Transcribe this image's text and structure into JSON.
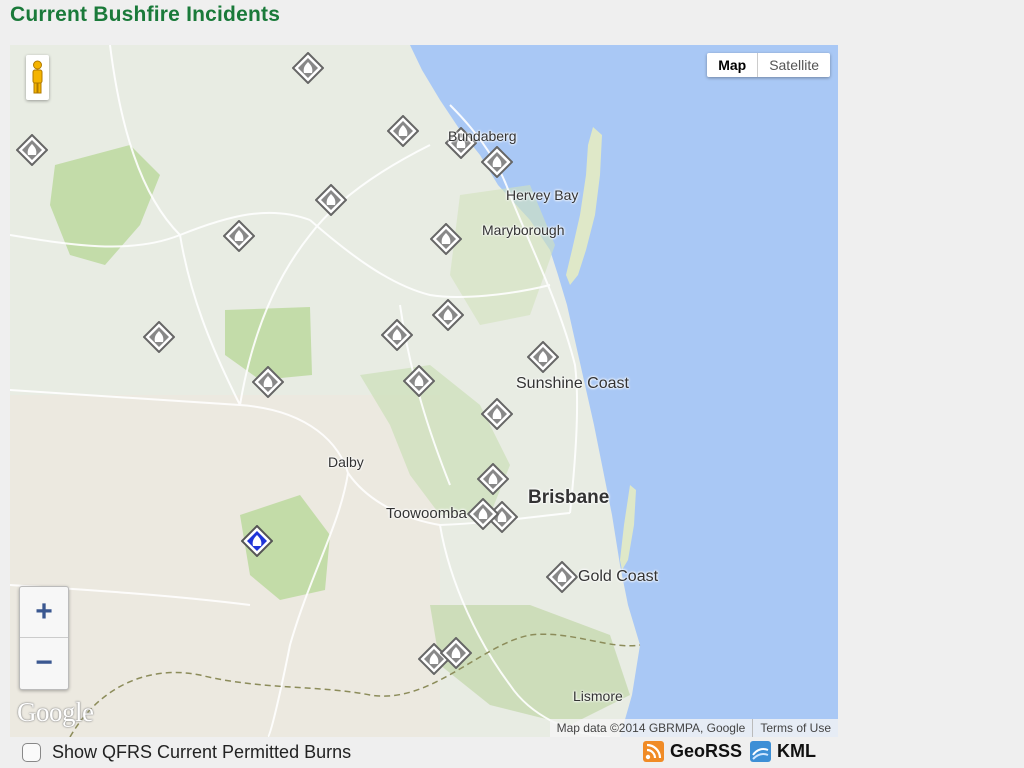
{
  "page": {
    "title": "Current Bushfire Incidents"
  },
  "map": {
    "type_buttons": [
      {
        "label": "Map",
        "active": true
      },
      {
        "label": "Satellite",
        "active": false
      }
    ],
    "zoom": {
      "in_label": "+",
      "out_label": "−"
    },
    "google_logo": "Google",
    "attribution": {
      "data": "Map data ©2014 GBRMPA, Google",
      "terms": "Terms of Use"
    },
    "cities": [
      {
        "name": "Bundaberg"
      },
      {
        "name": "Hervey Bay"
      },
      {
        "name": "Maryborough"
      },
      {
        "name": "Sunshine Coast"
      },
      {
        "name": "Dalby"
      },
      {
        "name": "Brisbane"
      },
      {
        "name": "Toowoomba"
      },
      {
        "name": "Gold Coast"
      },
      {
        "name": "Lismore"
      }
    ],
    "incident_count": 25,
    "colors": {
      "water": "#a9c8f5",
      "land": "#e8ece3",
      "park": "#b9d89a",
      "marker_gray": "#777777",
      "marker_blue": "#1f34d8",
      "title": "#1a7a3a"
    }
  },
  "controls": {
    "permitted_burns": {
      "label": "Show QFRS Current Permitted Burns",
      "checked": false
    },
    "feeds": [
      {
        "label": "GeoRSS",
        "icon": "rss-icon"
      },
      {
        "label": "KML",
        "icon": "kml-icon"
      }
    ]
  }
}
